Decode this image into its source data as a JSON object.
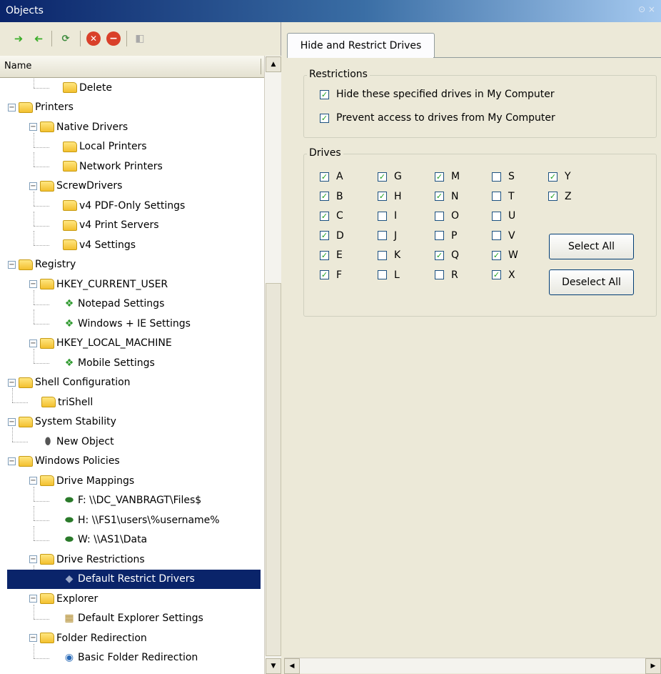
{
  "window": {
    "title": "Objects",
    "pin_glyph": "⊙ ×"
  },
  "toolbar": {
    "icons": [
      "forward-arrow-icon",
      "back-arrow-icon",
      "refresh-icon",
      "delete-icon",
      "remove-icon",
      "disabled-icon"
    ]
  },
  "tree": {
    "header": "Name",
    "items": [
      {
        "label": "Delete",
        "icon": "folder",
        "level": 2,
        "expander": false
      },
      {
        "label": "Printers",
        "icon": "folder",
        "level": 0,
        "expander": true
      },
      {
        "label": "Native Drivers",
        "icon": "folder",
        "level": 1,
        "expander": true
      },
      {
        "label": "Local Printers",
        "icon": "folder",
        "level": 2,
        "expander": false
      },
      {
        "label": "Network Printers",
        "icon": "folder",
        "level": 2,
        "expander": false
      },
      {
        "label": "ScrewDrivers",
        "icon": "folder",
        "level": 1,
        "expander": true
      },
      {
        "label": "v4 PDF-Only Settings",
        "icon": "folder",
        "level": 2,
        "expander": false
      },
      {
        "label": "v4 Print Servers",
        "icon": "folder",
        "level": 2,
        "expander": false
      },
      {
        "label": "v4 Settings",
        "icon": "folder",
        "level": 2,
        "expander": false
      },
      {
        "label": "Registry",
        "icon": "folder",
        "level": 0,
        "expander": true
      },
      {
        "label": "HKEY_CURRENT_USER",
        "icon": "folder",
        "level": 1,
        "expander": true
      },
      {
        "label": "Notepad Settings",
        "icon": "registry",
        "level": 2,
        "expander": false
      },
      {
        "label": "Windows + IE Settings",
        "icon": "registry",
        "level": 2,
        "expander": false
      },
      {
        "label": "HKEY_LOCAL_MACHINE",
        "icon": "folder",
        "level": 1,
        "expander": true
      },
      {
        "label": "Mobile Settings",
        "icon": "registry",
        "level": 2,
        "expander": false
      },
      {
        "label": "Shell Configuration",
        "icon": "folder",
        "level": 0,
        "expander": true
      },
      {
        "label": "triShell",
        "icon": "folder",
        "level": 1,
        "expander": false
      },
      {
        "label": "System Stability",
        "icon": "folder",
        "level": 0,
        "expander": true
      },
      {
        "label": "New Object",
        "icon": "object",
        "level": 1,
        "expander": false
      },
      {
        "label": "Windows Policies",
        "icon": "folder",
        "level": 0,
        "expander": true
      },
      {
        "label": "Drive Mappings",
        "icon": "folder",
        "level": 1,
        "expander": true
      },
      {
        "label": "F: \\\\DC_VANBRAGT\\Files$",
        "icon": "drive",
        "level": 2,
        "expander": false
      },
      {
        "label": "H: \\\\FS1\\users\\%username%",
        "icon": "drive",
        "level": 2,
        "expander": false
      },
      {
        "label": "W: \\\\AS1\\Data",
        "icon": "drive",
        "level": 2,
        "expander": false
      },
      {
        "label": "Drive Restrictions",
        "icon": "folder",
        "level": 1,
        "expander": true
      },
      {
        "label": "Default Restrict Drivers",
        "icon": "restrict",
        "level": 2,
        "expander": false,
        "selected": true
      },
      {
        "label": "Explorer",
        "icon": "folder",
        "level": 1,
        "expander": true
      },
      {
        "label": "Default Explorer Settings",
        "icon": "explorer",
        "level": 2,
        "expander": false
      },
      {
        "label": "Folder Redirection",
        "icon": "folder",
        "level": 1,
        "expander": true
      },
      {
        "label": "Basic Folder Redirection",
        "icon": "globe",
        "level": 2,
        "expander": false
      }
    ]
  },
  "tab": {
    "label": "Hide and Restrict Drives"
  },
  "restrictions": {
    "title": "Restrictions",
    "items": [
      {
        "label": "Hide these specified drives in My Computer",
        "checked": true
      },
      {
        "label": "Prevent access to drives from My Computer",
        "checked": true
      }
    ]
  },
  "drives": {
    "title": "Drives",
    "columns": [
      [
        {
          "l": "A",
          "c": true
        },
        {
          "l": "B",
          "c": true
        },
        {
          "l": "C",
          "c": true
        },
        {
          "l": "D",
          "c": true
        },
        {
          "l": "E",
          "c": true
        },
        {
          "l": "F",
          "c": true
        }
      ],
      [
        {
          "l": "G",
          "c": true
        },
        {
          "l": "H",
          "c": true
        },
        {
          "l": "I",
          "c": false
        },
        {
          "l": "J",
          "c": false
        },
        {
          "l": "K",
          "c": false
        },
        {
          "l": "L",
          "c": false
        }
      ],
      [
        {
          "l": "M",
          "c": true
        },
        {
          "l": "N",
          "c": true
        },
        {
          "l": "O",
          "c": false
        },
        {
          "l": "P",
          "c": false
        },
        {
          "l": "Q",
          "c": true
        },
        {
          "l": "R",
          "c": false
        }
      ],
      [
        {
          "l": "S",
          "c": false
        },
        {
          "l": "T",
          "c": false
        },
        {
          "l": "U",
          "c": false
        },
        {
          "l": "V",
          "c": false
        },
        {
          "l": "W",
          "c": true
        },
        {
          "l": "X",
          "c": true
        }
      ],
      [
        {
          "l": "Y",
          "c": true
        },
        {
          "l": "Z",
          "c": true
        }
      ]
    ],
    "select_all": "Select All",
    "deselect_all": "Deselect All"
  }
}
